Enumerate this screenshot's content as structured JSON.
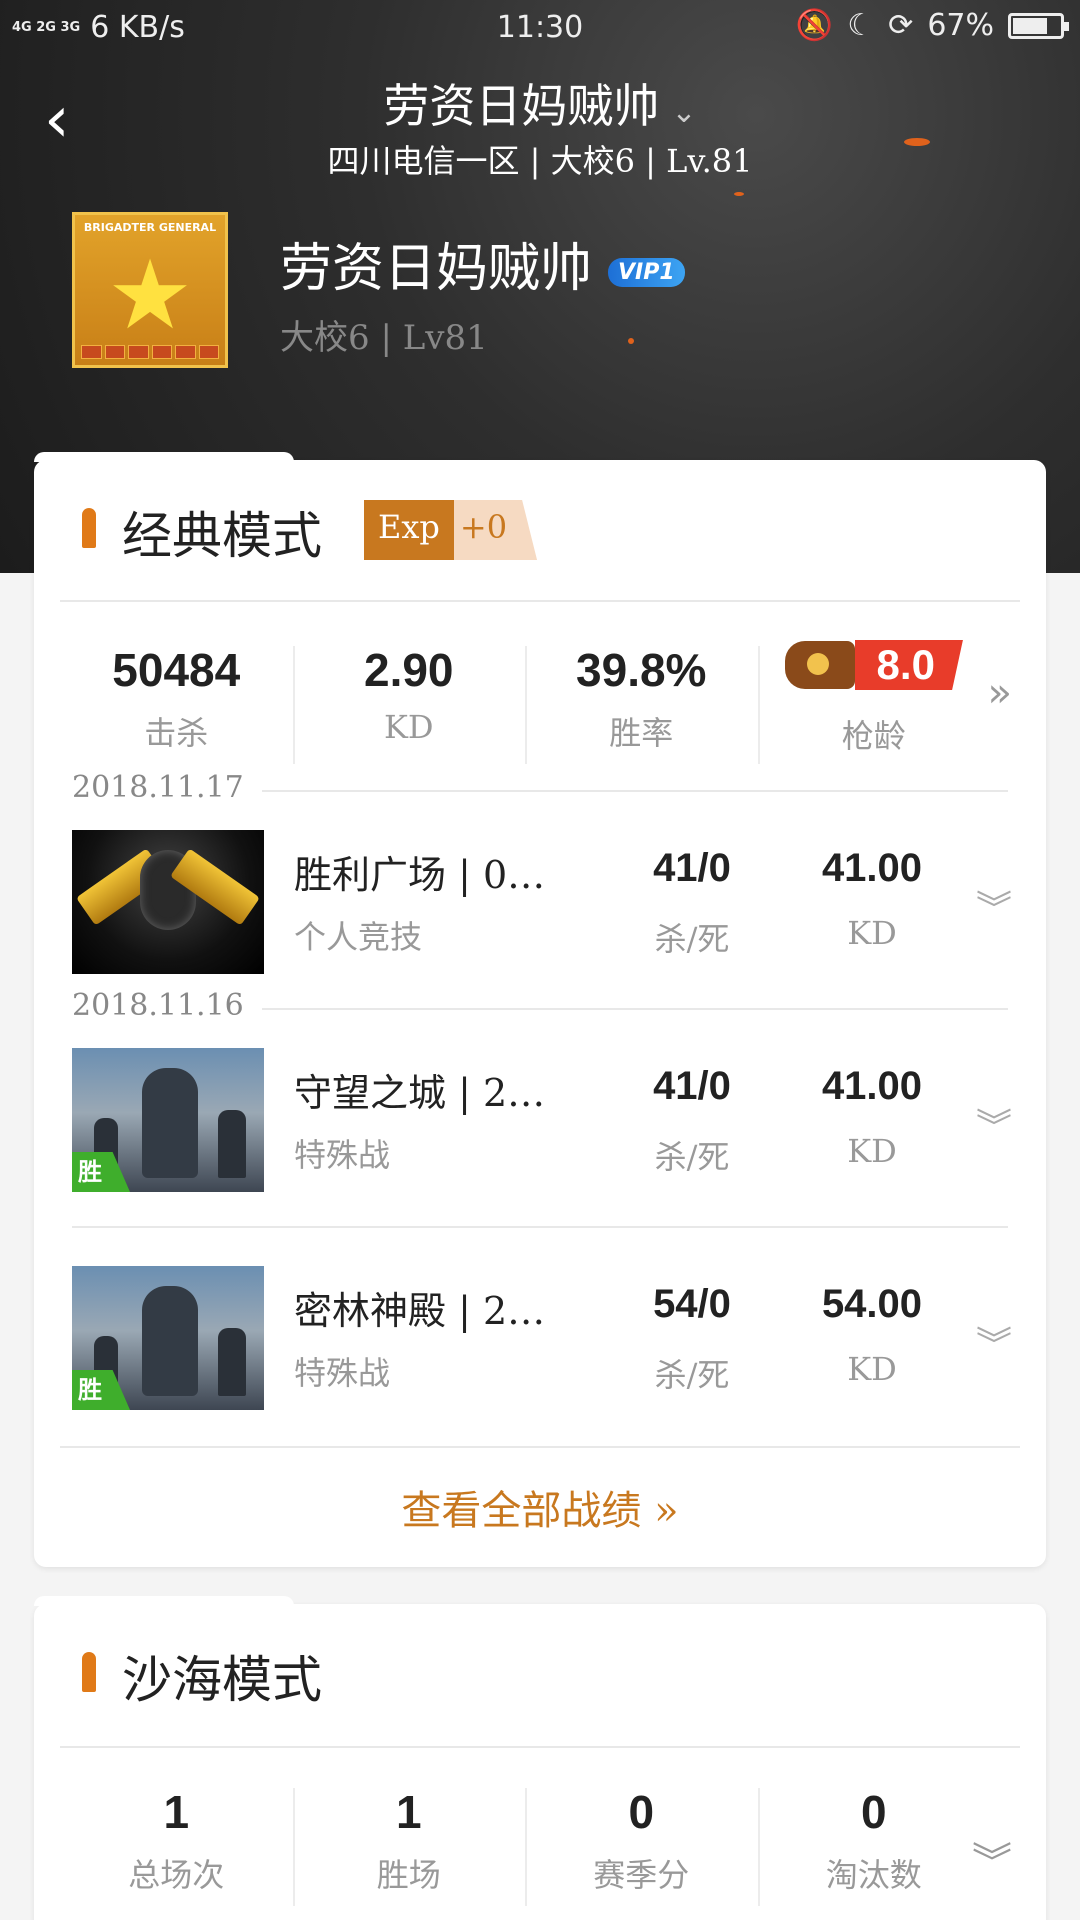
{
  "status_bar": {
    "network": "4G 2G 3G",
    "speed": "6 KB/s",
    "time": "11:30",
    "battery": "67%",
    "battery_level": 0.67
  },
  "nav": {
    "title": "劳资日妈贼帅",
    "subtitle": "四川电信一区 | 大校6 | Lv.81"
  },
  "profile": {
    "rank_badge_text": "BRIGADTER GENERAL",
    "name": "劳资日妈贼帅",
    "vip": "VIP1",
    "rank": "大校6 | Lv81"
  },
  "classic": {
    "title": "经典模式",
    "exp_label": "Exp",
    "exp_value": "+0",
    "stats": [
      {
        "value": "50484",
        "label": "击杀"
      },
      {
        "value": "2.90",
        "label": "KD"
      },
      {
        "value": "39.8%",
        "label": "胜率"
      }
    ],
    "gun_age": {
      "value": "8.0",
      "label": "枪龄"
    },
    "dates": [
      "2018.11.17",
      "2018.11.16"
    ],
    "matches": [
      {
        "map": "胜利广场 | 0…",
        "mode": "个人竞技",
        "kd_count": "41/0",
        "kd_count_label": "杀/死",
        "kd": "41.00",
        "kd_label": "KD",
        "win": ""
      },
      {
        "map": "守望之城 | 2…",
        "mode": "特殊战",
        "kd_count": "41/0",
        "kd_count_label": "杀/死",
        "kd": "41.00",
        "kd_label": "KD",
        "win": "胜"
      },
      {
        "map": "密林神殿 | 2…",
        "mode": "特殊战",
        "kd_count": "54/0",
        "kd_count_label": "杀/死",
        "kd": "54.00",
        "kd_label": "KD",
        "win": "胜"
      }
    ],
    "view_all": "查看全部战绩"
  },
  "sand": {
    "title": "沙海模式",
    "stats": [
      {
        "value": "1",
        "label": "总场次"
      },
      {
        "value": "1",
        "label": "胜场"
      },
      {
        "value": "0",
        "label": "赛季分"
      },
      {
        "value": "0",
        "label": "淘汰数"
      }
    ]
  },
  "colors": {
    "accent": "#c8781f",
    "win": "#3fae2c",
    "gun_red": "#e83c2a",
    "vip_blue": "#1d6fd6"
  }
}
